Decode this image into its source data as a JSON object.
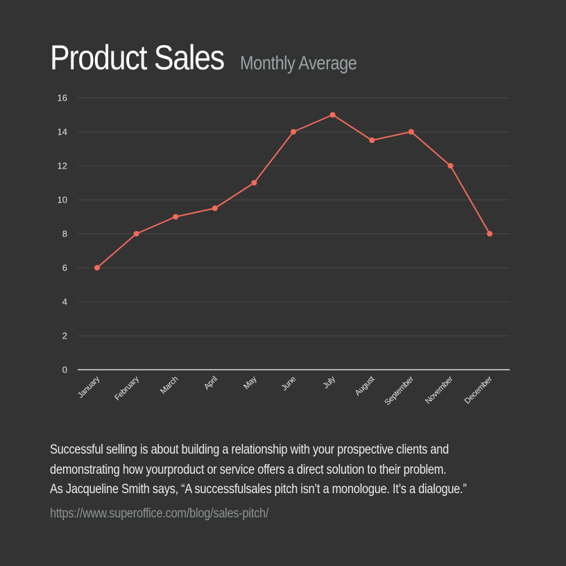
{
  "header": {
    "title": "Product Sales",
    "subtitle": "Monthly Average"
  },
  "chart_data": {
    "type": "line",
    "title": "Product Sales",
    "subtitle": "Monthly Average",
    "xlabel": "",
    "ylabel": "",
    "categories": [
      "January",
      "February",
      "March",
      "April",
      "May",
      "June",
      "July",
      "August",
      "September",
      "November",
      "December"
    ],
    "series": [
      {
        "name": "Product Sales",
        "color": "#f26b5b",
        "values": [
          6,
          8,
          9,
          9.5,
          11,
          14,
          15,
          13.5,
          14,
          12,
          8
        ]
      }
    ],
    "ylim": [
      0,
      16
    ],
    "yticks": [
      0,
      2,
      4,
      6,
      8,
      10,
      12,
      14,
      16
    ],
    "grid": true,
    "legend": "none"
  },
  "footer": {
    "lines": [
      "Successful selling is about building a relationship with your prospective clients and",
      "demonstrating how yourproduct or service offers a direct solution to their problem.",
      "As Jacqueline Smith says, “A successfulsales pitch isn’t a monologue. It’s a dialogue.”"
    ],
    "source": "https://www.superoffice.com/blog/sales-pitch/"
  },
  "colors": {
    "background": "#333333",
    "line": "#f26b5b",
    "grid": "#4a4a4a",
    "axis": "#ffffff",
    "title": "#ffffff",
    "subtitle": "#9aa3a6"
  }
}
